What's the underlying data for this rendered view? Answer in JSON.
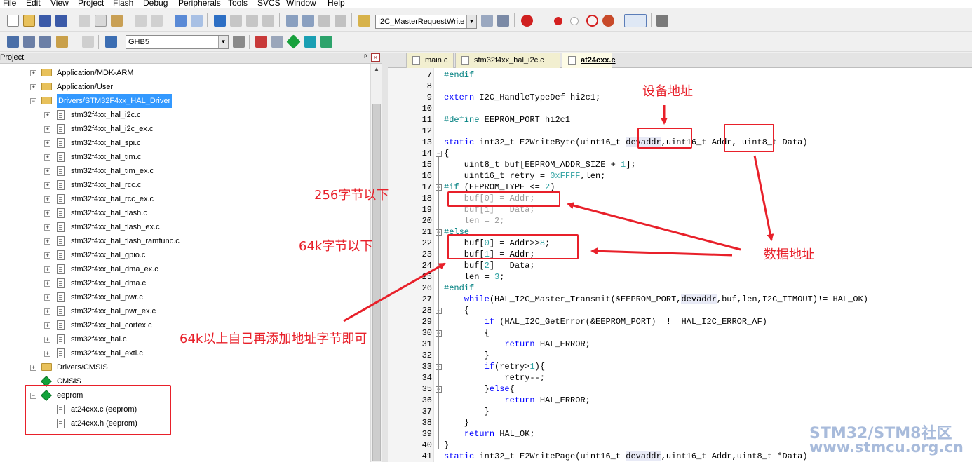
{
  "menubar": [
    "File",
    "Edit",
    "View",
    "Project",
    "Flash",
    "Debug",
    "Peripherals",
    "Tools",
    "SVCS",
    "Window",
    "Help"
  ],
  "toolbar": {
    "target_combo": "I2C_MasterRequestWrite",
    "build_combo": "GHB5"
  },
  "project_panel": {
    "title": "Project",
    "items": [
      {
        "label": "Application/MDK-ARM",
        "kind": "folder",
        "expanded": false
      },
      {
        "label": "Application/User",
        "kind": "folder",
        "expanded": false
      },
      {
        "label": "Drivers/STM32F4xx_HAL_Driver",
        "kind": "folder",
        "expanded": true,
        "selected": true
      },
      {
        "label": "stm32f4xx_hal_i2c.c",
        "kind": "file"
      },
      {
        "label": "stm32f4xx_hal_i2c_ex.c",
        "kind": "file"
      },
      {
        "label": "stm32f4xx_hal_spi.c",
        "kind": "file"
      },
      {
        "label": "stm32f4xx_hal_tim.c",
        "kind": "file"
      },
      {
        "label": "stm32f4xx_hal_tim_ex.c",
        "kind": "file"
      },
      {
        "label": "stm32f4xx_hal_rcc.c",
        "kind": "file"
      },
      {
        "label": "stm32f4xx_hal_rcc_ex.c",
        "kind": "file"
      },
      {
        "label": "stm32f4xx_hal_flash.c",
        "kind": "file"
      },
      {
        "label": "stm32f4xx_hal_flash_ex.c",
        "kind": "file"
      },
      {
        "label": "stm32f4xx_hal_flash_ramfunc.c",
        "kind": "file"
      },
      {
        "label": "stm32f4xx_hal_gpio.c",
        "kind": "file"
      },
      {
        "label": "stm32f4xx_hal_dma_ex.c",
        "kind": "file"
      },
      {
        "label": "stm32f4xx_hal_dma.c",
        "kind": "file"
      },
      {
        "label": "stm32f4xx_hal_pwr.c",
        "kind": "file"
      },
      {
        "label": "stm32f4xx_hal_pwr_ex.c",
        "kind": "file"
      },
      {
        "label": "stm32f4xx_hal_cortex.c",
        "kind": "file"
      },
      {
        "label": "stm32f4xx_hal.c",
        "kind": "file"
      },
      {
        "label": "stm32f4xx_hal_exti.c",
        "kind": "file"
      },
      {
        "label": "Drivers/CMSIS",
        "kind": "folder",
        "expanded": false
      },
      {
        "label": "CMSIS",
        "kind": "group"
      },
      {
        "label": "eeprom",
        "kind": "group",
        "expanded": true
      },
      {
        "label": "at24cxx.c (eeprom)",
        "kind": "file"
      },
      {
        "label": "at24cxx.h (eeprom)",
        "kind": "file"
      }
    ]
  },
  "tabs": [
    {
      "label": "main.c",
      "active": false
    },
    {
      "label": "stm32f4xx_hal_i2c.c",
      "active": false
    },
    {
      "label": "at24cxx.c",
      "active": true
    }
  ],
  "editor": {
    "lines": [
      {
        "n": "7",
        "html": "<span class=\"pp\">#endif</span>"
      },
      {
        "n": "8",
        "html": ""
      },
      {
        "n": "9",
        "html": "<span class=\"kw\">extern</span> I2C_HandleTypeDef hi2c1;"
      },
      {
        "n": "10",
        "html": ""
      },
      {
        "n": "11",
        "html": "<span class=\"pp\">#define</span> EEPROM_PORT hi2c1"
      },
      {
        "n": "12",
        "html": ""
      },
      {
        "n": "13",
        "html": "<span class=\"kw\">static</span> int32_t E2WriteByte(uint16_t <span class=\"hl\">devaddr</span>,uint16_t Addr, uint8_t Data)"
      },
      {
        "n": "14",
        "html": "{"
      },
      {
        "n": "15",
        "html": "    uint8_t buf[EEPROM_ADDR_SIZE + <span class=\"num\">1</span>];"
      },
      {
        "n": "16",
        "html": "    uint16_t retry = <span class=\"num\">0xFFFF</span>,len;"
      },
      {
        "n": "17",
        "html": "<span class=\"pp\">#if</span> (EEPROM_TYPE &lt;= <span class=\"num\">2</span>)"
      },
      {
        "n": "18",
        "html": "<span class=\"inact\">    buf[0] = Addr;</span>"
      },
      {
        "n": "19",
        "html": "<span class=\"inact\">    buf[1] = Data;</span>"
      },
      {
        "n": "20",
        "html": "<span class=\"inact\">    len = 2;</span>"
      },
      {
        "n": "21",
        "html": "<span class=\"pp\">#else</span>"
      },
      {
        "n": "22",
        "html": "    buf[<span class=\"num\">0</span>] = Addr&gt;&gt;<span class=\"num\">8</span>;"
      },
      {
        "n": "23",
        "html": "    buf[<span class=\"num\">1</span>] = Addr;"
      },
      {
        "n": "24",
        "html": "    buf[<span class=\"num\">2</span>] = Data;"
      },
      {
        "n": "25",
        "html": "    len = <span class=\"num\">3</span>;"
      },
      {
        "n": "26",
        "html": "<span class=\"pp\">#endif</span>"
      },
      {
        "n": "27",
        "html": "    <span class=\"kw\">while</span>(HAL_I2C_Master_Transmit(&amp;EEPROM_PORT,<span class=\"hl\">devaddr</span>,buf,len,I2C_TIMOUT)!= HAL_OK)"
      },
      {
        "n": "28",
        "html": "    {"
      },
      {
        "n": "29",
        "html": "        <span class=\"kw\">if</span> (HAL_I2C_GetError(&amp;EEPROM_PORT)  != HAL_I2C_ERROR_AF)"
      },
      {
        "n": "30",
        "html": "        {"
      },
      {
        "n": "31",
        "html": "            <span class=\"kw\">return</span> HAL_ERROR;"
      },
      {
        "n": "32",
        "html": "        }"
      },
      {
        "n": "33",
        "html": "        <span class=\"kw\">if</span>(retry&gt;<span class=\"num\">1</span>){"
      },
      {
        "n": "34",
        "html": "            retry--;"
      },
      {
        "n": "35",
        "html": "        }<span class=\"kw\">else</span>{"
      },
      {
        "n": "36",
        "html": "            <span class=\"kw\">return</span> HAL_ERROR;"
      },
      {
        "n": "37",
        "html": "        }"
      },
      {
        "n": "38",
        "html": "    }"
      },
      {
        "n": "39",
        "html": "    <span class=\"kw\">return</span> HAL_OK;"
      },
      {
        "n": "40",
        "html": "}"
      },
      {
        "n": "41",
        "html": "<span class=\"kw\">static</span> int32_t E2WritePage(uint16_t <span class=\"hl\">devaddr</span>,uint16_t Addr,uint8_t *Data)"
      }
    ]
  },
  "annotations": {
    "device_addr": "设备地址",
    "data_addr": "数据地址",
    "under_256": "256字节以下",
    "under_64k": "64k字节以下",
    "over_64k": "64k以上自己再添加地址字节即可"
  },
  "watermark": {
    "line1": "STM32/STM8社区",
    "line2": "www.stmcu.org.cn"
  },
  "colors": {
    "annotation_red": "#e8202a",
    "selection_blue": "#3399ff",
    "keyword_blue": "#0000ff",
    "preproc_teal": "#008080",
    "watermark": "#9fb4d8"
  }
}
